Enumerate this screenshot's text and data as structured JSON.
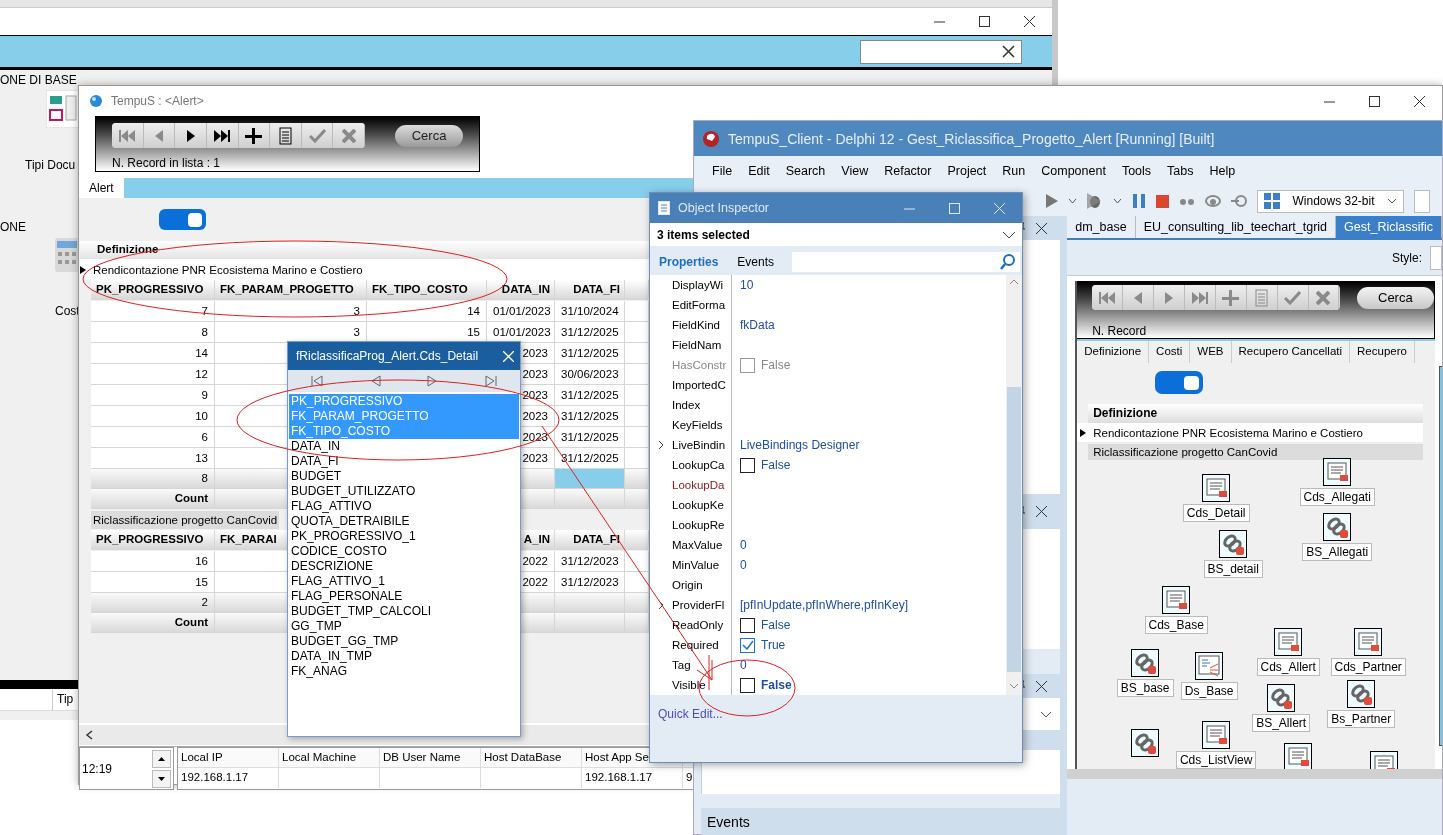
{
  "background_window": {
    "sidebar_labels": [
      "ONE DI BASE",
      "Tipi Docu",
      "ONE",
      "Cost"
    ],
    "bottom_tab": "Tip"
  },
  "alert_window": {
    "title": "TempuS : <Alert>",
    "record_count": "N. Record in lista : 1",
    "search_button": "Cerca",
    "nav_buttons": [
      {
        "kind": "first",
        "disabled": true
      },
      {
        "kind": "prior",
        "disabled": true
      },
      {
        "kind": "next",
        "disabled": false
      },
      {
        "kind": "last",
        "disabled": false
      },
      {
        "kind": "insert",
        "disabled": false
      },
      {
        "kind": "edit",
        "disabled": false
      },
      {
        "kind": "post",
        "disabled": true
      },
      {
        "kind": "cancel",
        "disabled": true
      }
    ],
    "tabs": [
      {
        "label": "Alert",
        "selected": true
      }
    ],
    "toggle": {
      "on": true
    },
    "grid": {
      "group_column": "Definizione",
      "groups": [
        {
          "title": "Rendicontazione PNR Ecosistema Marino e Costiero",
          "current": true,
          "columns": {
            "pk_progressivo": "PK_PROGRESSIVO",
            "fk_param_progetto": "FK_PARAM_PROGETTO",
            "fk_tipo_costo": "FK_TIPO_COSTO",
            "data_in": "DATA_IN",
            "data_fi": "DATA_FI"
          },
          "rows": [
            {
              "pk_progressivo": "7",
              "fk_param_progetto": "3",
              "fk_tipo_costo": "14",
              "data_in": "01/01/2023",
              "data_fi": "31/10/2024"
            },
            {
              "pk_progressivo": "8",
              "fk_param_progetto": "3",
              "fk_tipo_costo": "15",
              "data_in": "01/01/2023",
              "data_fi": "31/12/2025"
            },
            {
              "pk_progressivo": "14",
              "data_in": "2023",
              "data_fi": "31/12/2025"
            },
            {
              "pk_progressivo": "12",
              "data_in": "2023",
              "data_fi": "30/06/2023"
            },
            {
              "pk_progressivo": "9",
              "data_in": "2023",
              "data_fi": "31/12/2025"
            },
            {
              "pk_progressivo": "10",
              "data_in": "2023",
              "data_fi": "31/12/2025"
            },
            {
              "pk_progressivo": "6",
              "data_in": "2023",
              "data_fi": "31/12/2025"
            },
            {
              "pk_progressivo": "13",
              "data_in": "2023",
              "data_fi": "31/12/2025"
            }
          ],
          "footer": {
            "pk_progressivo": "8"
          },
          "data_fi_selected": true,
          "count_label": "Count"
        },
        {
          "title": "Riclassificazione progetto CanCovid",
          "current": false,
          "columns": {
            "pk_progressivo": "PK_PROGRESSIVO",
            "fk_param_progetto": "FK_PARAI",
            "data_in": "A_IN",
            "data_fi": "DATA_FI"
          },
          "rows": [
            {
              "pk_progressivo": "16",
              "data_in": "2022",
              "data_fi": "31/12/2023"
            },
            {
              "pk_progressivo": "15",
              "data_in": "2022",
              "data_fi": "31/12/2023"
            }
          ],
          "footer": {
            "pk_progressivo": "2"
          },
          "data_fi_selected": false,
          "count_label": "Count"
        }
      ]
    },
    "status": {
      "time": "12:19",
      "columns": [
        "Local IP",
        "Local Machine",
        "DB User Name",
        "Host DataBase",
        "Host App Se"
      ],
      "values": {
        "local_ip": "192.168.1.17",
        "host_app": "192.168.1.17",
        "column_6": "9"
      }
    }
  },
  "detail_popup": {
    "title": "fRiclassificaProg_Alert.Cds_Detail",
    "fields": [
      {
        "name": "PK_PROGRESSIVO",
        "selected": true
      },
      {
        "name": "FK_PARAM_PROGETTO",
        "selected": true
      },
      {
        "name": "FK_TIPO_COSTO",
        "selected": true
      },
      {
        "name": "DATA_IN",
        "selected": false
      },
      {
        "name": "DATA_FI",
        "selected": false
      },
      {
        "name": "BUDGET",
        "selected": false
      },
      {
        "name": "BUDGET_UTILIZZATO",
        "selected": false
      },
      {
        "name": "FLAG_ATTIVO",
        "selected": false
      },
      {
        "name": "QUOTA_DETRAIBILE",
        "selected": false
      },
      {
        "name": "PK_PROGRESSIVO_1",
        "selected": false
      },
      {
        "name": "CODICE_COSTO",
        "selected": false
      },
      {
        "name": "DESCRIZIONE",
        "selected": false
      },
      {
        "name": "FLAG_ATTIVO_1",
        "selected": false
      },
      {
        "name": "FLAG_PERSONALE",
        "selected": false
      },
      {
        "name": "BUDGET_TMP_CALCOLI",
        "selected": false
      },
      {
        "name": "GG_TMP",
        "selected": false
      },
      {
        "name": "BUDGET_GG_TMP",
        "selected": false
      },
      {
        "name": "DATA_IN_TMP",
        "selected": false
      },
      {
        "name": "FK_ANAG",
        "selected": false
      }
    ]
  },
  "ide_window": {
    "title": "TempuS_Client - Delphi 12 - Gest_Riclassifica_Progetto_Alert [Running] [Built]",
    "menu": [
      "File",
      "Edit",
      "Search",
      "View",
      "Refactor",
      "Project",
      "Run",
      "Component",
      "Tools",
      "Tabs",
      "Help"
    ],
    "platform": "Windows 32-bit",
    "tabs": [
      {
        "label": "dm_base",
        "selected": false
      },
      {
        "label": "EU_consulting_lib_teechart_tgrid",
        "selected": false
      },
      {
        "label": "Gest_Riclassific",
        "selected": true
      }
    ],
    "style_label": "Style:",
    "designer": {
      "record_label": "N. Record",
      "search_button": "Cerca",
      "tabs": [
        "Definizione",
        "Costi",
        "WEB",
        "Recupero Cancellati",
        "Recupero"
      ],
      "toggle": {
        "on": true
      },
      "grid_header": "Definizione",
      "rows": [
        {
          "text": "Rendicontazione PNR Ecosistema Marino e Costiero",
          "current": true
        },
        {
          "text": "Riclassificazione progetto CanCovid",
          "current": false
        }
      ],
      "components": [
        {
          "name": "Cds_Detail",
          "kind": "dataset"
        },
        {
          "name": "Cds_Allegati",
          "kind": "dataset"
        },
        {
          "name": "BS_detail",
          "kind": "source"
        },
        {
          "name": "BS_Allegati",
          "kind": "source"
        },
        {
          "name": "Cds_Base",
          "kind": "dataset"
        },
        {
          "name": "BS_base",
          "kind": "source"
        },
        {
          "name": "Ds_Base",
          "kind": "provider"
        },
        {
          "name": "Cds_Allert",
          "kind": "dataset"
        },
        {
          "name": "Cds_Partner",
          "kind": "dataset"
        },
        {
          "name": "BS_Allert",
          "kind": "source"
        },
        {
          "name": "Bs_Partner",
          "kind": "source"
        },
        {
          "name": "Cds_ListView",
          "kind": "dataset"
        },
        {
          "kind": "source"
        },
        {
          "kind": "dataset"
        },
        {
          "kind": "dataset"
        }
      ]
    },
    "bottom_panel": "Events"
  },
  "object_inspector": {
    "title": "Object Inspector",
    "selection": "3 items selected",
    "tabs": [
      {
        "label": "Properties",
        "selected": true
      },
      {
        "label": "Events",
        "selected": false
      }
    ],
    "properties": [
      {
        "name": "DisplayWi",
        "kind": "text",
        "value": "10",
        "disabled": false,
        "reference": false,
        "expandable": false
      },
      {
        "name": "EditForma",
        "kind": "text",
        "disabled": false,
        "reference": false,
        "expandable": false
      },
      {
        "name": "FieldKind",
        "kind": "text",
        "value": "fkData",
        "disabled": false,
        "reference": false,
        "expandable": false
      },
      {
        "name": "FieldNam",
        "kind": "text",
        "disabled": false,
        "reference": false,
        "expandable": false
      },
      {
        "name": "HasConstr",
        "kind": "check",
        "checked": false,
        "value": "False",
        "disabled": true,
        "reference": false,
        "expandable": false
      },
      {
        "name": "ImportedC",
        "kind": "text",
        "disabled": false,
        "reference": false,
        "expandable": false
      },
      {
        "name": "Index",
        "kind": "text",
        "disabled": false,
        "reference": false,
        "expandable": false
      },
      {
        "name": "KeyFields",
        "kind": "text",
        "disabled": false,
        "reference": false,
        "expandable": false
      },
      {
        "name": "LiveBindin",
        "kind": "text",
        "value": "LiveBindings Designer",
        "disabled": false,
        "reference": false,
        "expandable": true
      },
      {
        "name": "LookupCa",
        "kind": "check",
        "checked": false,
        "value": "False",
        "disabled": false,
        "reference": false,
        "expandable": false
      },
      {
        "name": "LookupDa",
        "kind": "text",
        "disabled": false,
        "reference": true,
        "expandable": false
      },
      {
        "name": "LookupKe",
        "kind": "text",
        "disabled": false,
        "reference": false,
        "expandable": false
      },
      {
        "name": "LookupRe",
        "kind": "text",
        "disabled": false,
        "reference": false,
        "expandable": false
      },
      {
        "name": "MaxValue",
        "kind": "text",
        "value": "0",
        "disabled": false,
        "reference": false,
        "expandable": false
      },
      {
        "name": "MinValue",
        "kind": "text",
        "value": "0",
        "disabled": false,
        "reference": false,
        "expandable": false
      },
      {
        "name": "Origin",
        "kind": "text",
        "disabled": false,
        "reference": false,
        "expandable": false
      },
      {
        "name": "ProviderFl",
        "kind": "text",
        "value": "[pfInUpdate,pfInWhere,pfInKey]",
        "disabled": false,
        "reference": false,
        "expandable": true
      },
      {
        "name": "ReadOnly",
        "kind": "check",
        "checked": false,
        "value": "False",
        "disabled": false,
        "reference": false,
        "expandable": false
      },
      {
        "name": "Required",
        "kind": "check",
        "checked": true,
        "value": "True",
        "disabled": false,
        "reference": false,
        "expandable": false
      },
      {
        "name": "Tag",
        "kind": "text",
        "value": "0",
        "disabled": false,
        "reference": false,
        "expandable": false
      },
      {
        "name": "Visible",
        "kind": "changedcheck",
        "checked": false,
        "value": "False",
        "disabled": false,
        "reference": false,
        "expandable": false
      }
    ],
    "quick_edit": "Quick Edit..."
  }
}
